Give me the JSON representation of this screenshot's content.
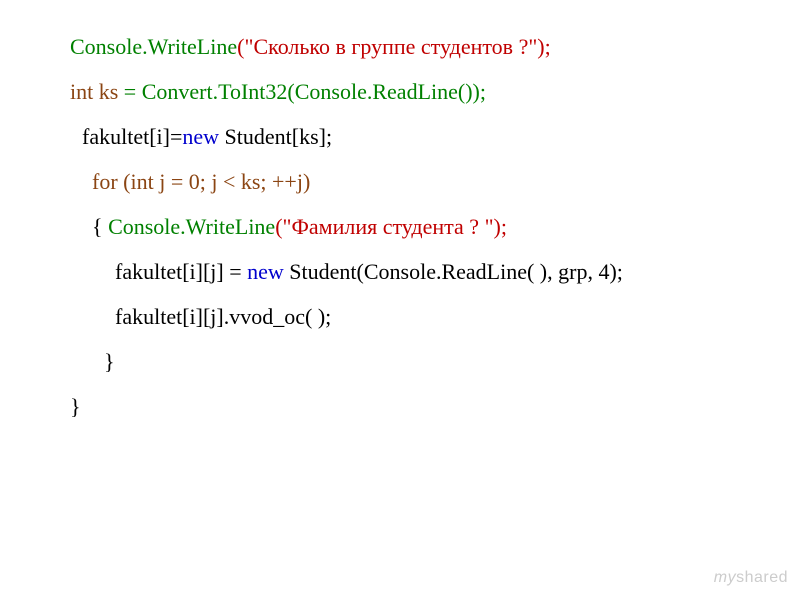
{
  "lines": {
    "l1": {
      "p1": "Console.WriteLine",
      "p2": "(\"Сколько в группе студентов ?\");"
    },
    "l2": {
      "p1": "int ks ",
      "p2": "= Convert.ToInt32(Console.ReadLine());"
    },
    "l3": {
      "p1": "fakultet[i]=",
      "p2": "new ",
      "p3": "Student[ks];"
    },
    "l4": {
      "p1": "for (int j = 0; j < ks; ++j)"
    },
    "l5": {
      "p1": "{   ",
      "p2": "Console.WriteLine",
      "p3": "(\"Фамилия студента ? \");"
    },
    "l6": {
      "p1": "fakultet[i][j] = ",
      "p2": "new ",
      "p3": "Student(Console.ReadLine( ), grp, 4);"
    },
    "l7": {
      "p1": "fakultet[i][j].vvod_oc( );"
    },
    "l8": {
      "p1": "}"
    },
    "l9": {
      "p1": "}"
    }
  },
  "watermark": "myshared"
}
